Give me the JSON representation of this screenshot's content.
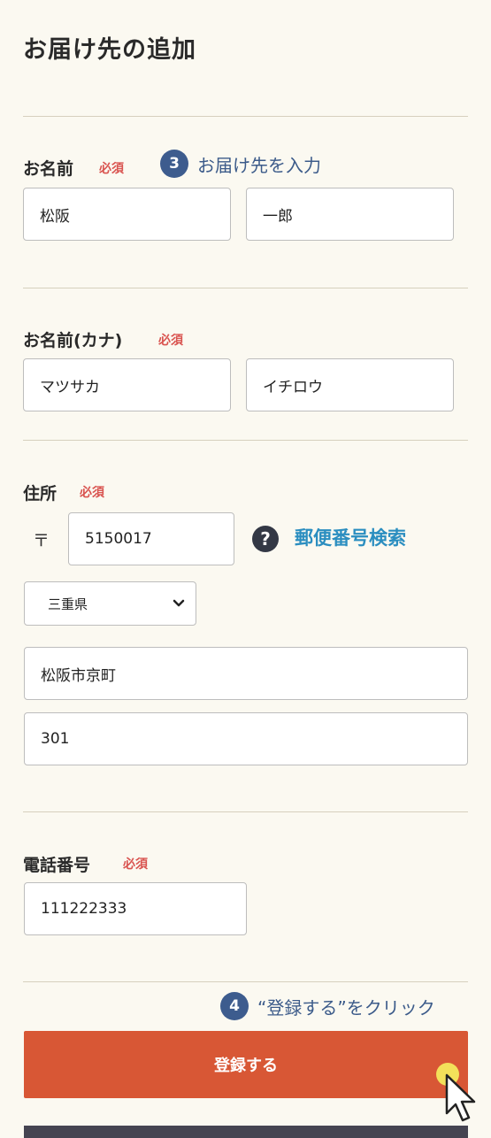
{
  "page_title": "お届け先の追加",
  "required_label": "必須",
  "name_section": {
    "label": "お名前",
    "last_name": "松阪",
    "first_name": "一郎"
  },
  "step3": {
    "number": "3",
    "text": "お届け先を入力"
  },
  "kana_section": {
    "label": "お名前(カナ)",
    "last_kana": "マツサカ",
    "first_kana": "イチロウ"
  },
  "address_section": {
    "label": "住所",
    "postal_mark": "〒",
    "postal_code": "5150017",
    "help_symbol": "?",
    "postal_search_link": "郵便番号検索",
    "prefecture": "三重県",
    "city": "松阪市京町",
    "address2": "301"
  },
  "phone_section": {
    "label": "電話番号",
    "phone": "111222333"
  },
  "step4": {
    "number": "4",
    "text": "“登録する”をクリック"
  },
  "register_button": "登録する",
  "icons": {
    "help": "question-circle-icon",
    "select_arrow": "chevron-down-icon",
    "cursor": "pointer-cursor-icon"
  },
  "colors": {
    "accent": "#d85735",
    "link": "#2b8ec0",
    "required": "#d9534f",
    "annotation": "#3d5c8e"
  }
}
